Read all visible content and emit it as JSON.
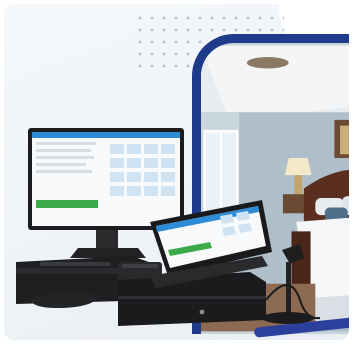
{
  "scene": {
    "subject": "point-of-sale-terminals",
    "background_subject": "bedroom",
    "colors": {
      "frame": "#1e3a8a",
      "accent": "#2e8bd6",
      "hardware": "#1c1c1e",
      "screen_green": "#3caa4b"
    }
  }
}
